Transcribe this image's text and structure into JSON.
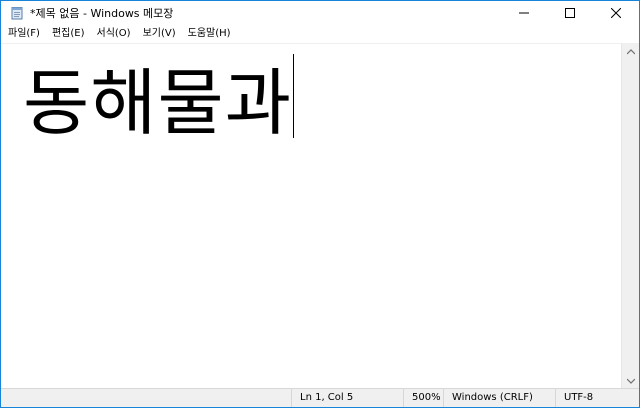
{
  "window": {
    "title": "*제목 없음 - Windows 메모장",
    "icon": "notepad-icon",
    "border_color": "#1883d7"
  },
  "controls": {
    "minimize_icon": "minimize-icon",
    "maximize_icon": "maximize-icon",
    "close_icon": "close-icon"
  },
  "menu": {
    "items": [
      {
        "label": "파일(F)"
      },
      {
        "label": "편집(E)"
      },
      {
        "label": "서식(O)"
      },
      {
        "label": "보기(V)"
      },
      {
        "label": "도움말(H)"
      }
    ]
  },
  "editor": {
    "text": "동해물과"
  },
  "statusbar": {
    "position": "Ln 1, Col 5",
    "zoom": "500%",
    "line_ending": "Windows (CRLF)",
    "encoding": "UTF-8"
  }
}
